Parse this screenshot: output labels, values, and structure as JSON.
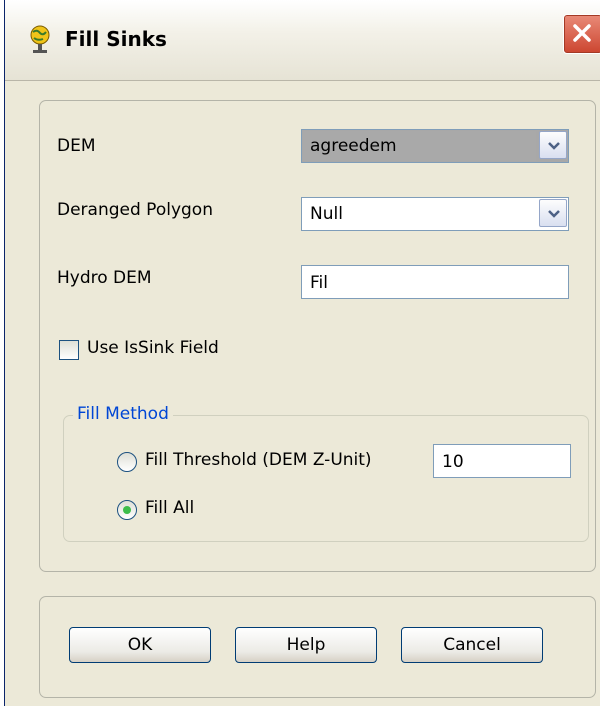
{
  "window": {
    "title": "Fill Sinks",
    "title_icon": "globe-icon",
    "close_icon": "close-icon"
  },
  "form": {
    "dem": {
      "label": "DEM",
      "value": "agreedem"
    },
    "deranged_polygon": {
      "label": "Deranged Polygon",
      "value": "Null"
    },
    "hydro_dem": {
      "label": "Hydro DEM",
      "value": "Fil"
    },
    "use_issink": {
      "label": "Use IsSink Field",
      "checked": false
    }
  },
  "fill_method": {
    "legend": "Fill Method",
    "threshold": {
      "label": "Fill Threshold (DEM Z-Unit)",
      "value": "10",
      "selected": false
    },
    "fill_all": {
      "label": "Fill All",
      "selected": true
    }
  },
  "buttons": {
    "ok": "OK",
    "help": "Help",
    "cancel": "Cancel"
  },
  "colors": {
    "dialog_bg": "#ece9d8",
    "legend_blue": "#0046d5",
    "radio_green": "#3dbd4b",
    "close_red": "#cc4530"
  }
}
